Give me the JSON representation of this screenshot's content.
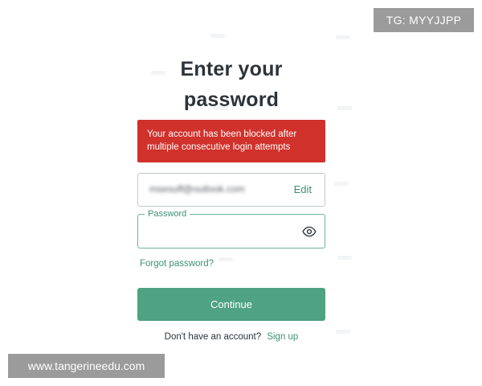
{
  "page": {
    "title_line1": "Enter your",
    "title_line2": "password"
  },
  "error": {
    "message": "Your account has been blocked after multiple consecutive login attempts"
  },
  "email_field": {
    "value": "msesuff@outlook.com",
    "edit_label": "Edit"
  },
  "password_field": {
    "label": "Password",
    "value": "",
    "toggle_icon": "eye-icon"
  },
  "links": {
    "forgot_password": "Forgot password?"
  },
  "actions": {
    "continue_label": "Continue"
  },
  "signup": {
    "prompt": "Don't have an account?",
    "link_label": "Sign up"
  },
  "overlays": {
    "tg_label": "TG: MYYJJPP",
    "site_label": "www.tangerineedu.com"
  },
  "colors": {
    "accent": "#4fa283",
    "link": "#3d8f76",
    "error_bg": "#d0312b"
  }
}
